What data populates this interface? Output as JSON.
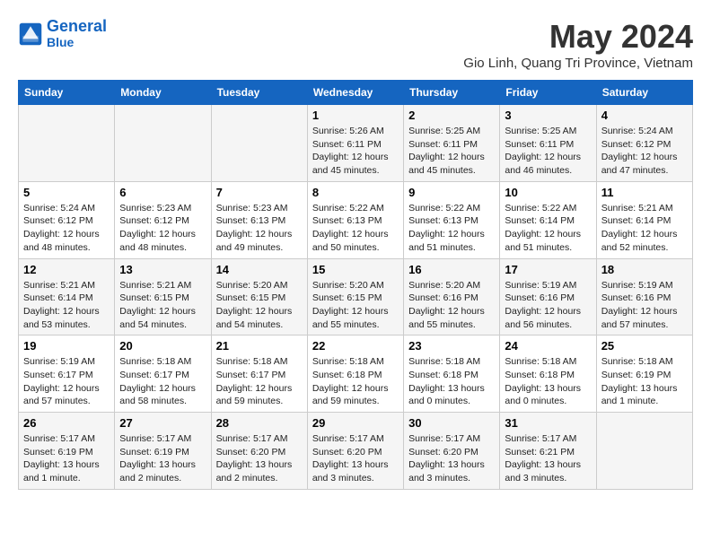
{
  "header": {
    "logo_line1": "General",
    "logo_line2": "Blue",
    "title": "May 2024",
    "subtitle": "Gio Linh, Quang Tri Province, Vietnam"
  },
  "weekdays": [
    "Sunday",
    "Monday",
    "Tuesday",
    "Wednesday",
    "Thursday",
    "Friday",
    "Saturday"
  ],
  "weeks": [
    [
      {
        "day": "",
        "info": ""
      },
      {
        "day": "",
        "info": ""
      },
      {
        "day": "",
        "info": ""
      },
      {
        "day": "1",
        "info": "Sunrise: 5:26 AM\nSunset: 6:11 PM\nDaylight: 12 hours\nand 45 minutes."
      },
      {
        "day": "2",
        "info": "Sunrise: 5:25 AM\nSunset: 6:11 PM\nDaylight: 12 hours\nand 45 minutes."
      },
      {
        "day": "3",
        "info": "Sunrise: 5:25 AM\nSunset: 6:11 PM\nDaylight: 12 hours\nand 46 minutes."
      },
      {
        "day": "4",
        "info": "Sunrise: 5:24 AM\nSunset: 6:12 PM\nDaylight: 12 hours\nand 47 minutes."
      }
    ],
    [
      {
        "day": "5",
        "info": "Sunrise: 5:24 AM\nSunset: 6:12 PM\nDaylight: 12 hours\nand 48 minutes."
      },
      {
        "day": "6",
        "info": "Sunrise: 5:23 AM\nSunset: 6:12 PM\nDaylight: 12 hours\nand 48 minutes."
      },
      {
        "day": "7",
        "info": "Sunrise: 5:23 AM\nSunset: 6:13 PM\nDaylight: 12 hours\nand 49 minutes."
      },
      {
        "day": "8",
        "info": "Sunrise: 5:22 AM\nSunset: 6:13 PM\nDaylight: 12 hours\nand 50 minutes."
      },
      {
        "day": "9",
        "info": "Sunrise: 5:22 AM\nSunset: 6:13 PM\nDaylight: 12 hours\nand 51 minutes."
      },
      {
        "day": "10",
        "info": "Sunrise: 5:22 AM\nSunset: 6:14 PM\nDaylight: 12 hours\nand 51 minutes."
      },
      {
        "day": "11",
        "info": "Sunrise: 5:21 AM\nSunset: 6:14 PM\nDaylight: 12 hours\nand 52 minutes."
      }
    ],
    [
      {
        "day": "12",
        "info": "Sunrise: 5:21 AM\nSunset: 6:14 PM\nDaylight: 12 hours\nand 53 minutes."
      },
      {
        "day": "13",
        "info": "Sunrise: 5:21 AM\nSunset: 6:15 PM\nDaylight: 12 hours\nand 54 minutes."
      },
      {
        "day": "14",
        "info": "Sunrise: 5:20 AM\nSunset: 6:15 PM\nDaylight: 12 hours\nand 54 minutes."
      },
      {
        "day": "15",
        "info": "Sunrise: 5:20 AM\nSunset: 6:15 PM\nDaylight: 12 hours\nand 55 minutes."
      },
      {
        "day": "16",
        "info": "Sunrise: 5:20 AM\nSunset: 6:16 PM\nDaylight: 12 hours\nand 55 minutes."
      },
      {
        "day": "17",
        "info": "Sunrise: 5:19 AM\nSunset: 6:16 PM\nDaylight: 12 hours\nand 56 minutes."
      },
      {
        "day": "18",
        "info": "Sunrise: 5:19 AM\nSunset: 6:16 PM\nDaylight: 12 hours\nand 57 minutes."
      }
    ],
    [
      {
        "day": "19",
        "info": "Sunrise: 5:19 AM\nSunset: 6:17 PM\nDaylight: 12 hours\nand 57 minutes."
      },
      {
        "day": "20",
        "info": "Sunrise: 5:18 AM\nSunset: 6:17 PM\nDaylight: 12 hours\nand 58 minutes."
      },
      {
        "day": "21",
        "info": "Sunrise: 5:18 AM\nSunset: 6:17 PM\nDaylight: 12 hours\nand 59 minutes."
      },
      {
        "day": "22",
        "info": "Sunrise: 5:18 AM\nSunset: 6:18 PM\nDaylight: 12 hours\nand 59 minutes."
      },
      {
        "day": "23",
        "info": "Sunrise: 5:18 AM\nSunset: 6:18 PM\nDaylight: 13 hours\nand 0 minutes."
      },
      {
        "day": "24",
        "info": "Sunrise: 5:18 AM\nSunset: 6:18 PM\nDaylight: 13 hours\nand 0 minutes."
      },
      {
        "day": "25",
        "info": "Sunrise: 5:18 AM\nSunset: 6:19 PM\nDaylight: 13 hours\nand 1 minute."
      }
    ],
    [
      {
        "day": "26",
        "info": "Sunrise: 5:17 AM\nSunset: 6:19 PM\nDaylight: 13 hours\nand 1 minute."
      },
      {
        "day": "27",
        "info": "Sunrise: 5:17 AM\nSunset: 6:19 PM\nDaylight: 13 hours\nand 2 minutes."
      },
      {
        "day": "28",
        "info": "Sunrise: 5:17 AM\nSunset: 6:20 PM\nDaylight: 13 hours\nand 2 minutes."
      },
      {
        "day": "29",
        "info": "Sunrise: 5:17 AM\nSunset: 6:20 PM\nDaylight: 13 hours\nand 3 minutes."
      },
      {
        "day": "30",
        "info": "Sunrise: 5:17 AM\nSunset: 6:20 PM\nDaylight: 13 hours\nand 3 minutes."
      },
      {
        "day": "31",
        "info": "Sunrise: 5:17 AM\nSunset: 6:21 PM\nDaylight: 13 hours\nand 3 minutes."
      },
      {
        "day": "",
        "info": ""
      }
    ]
  ]
}
